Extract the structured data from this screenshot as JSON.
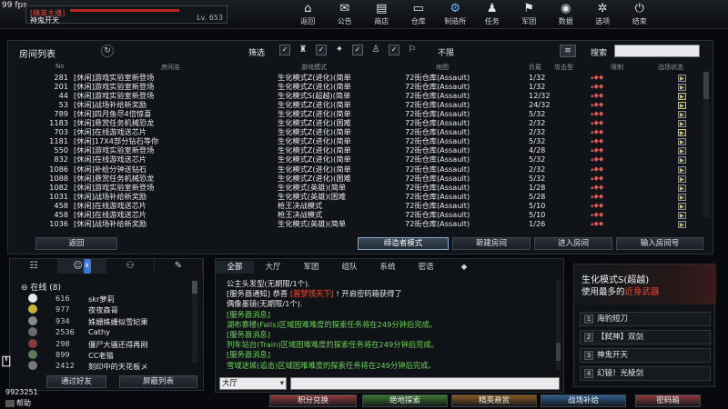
{
  "fps": "99 fps",
  "player": {
    "rank": "[精英主播]",
    "name": "神鬼开天",
    "level": "Lv. 653"
  },
  "menu": [
    {
      "label": "返回",
      "icon": "⌂"
    },
    {
      "label": "公告",
      "icon": "✉"
    },
    {
      "label": "商店",
      "icon": "▤"
    },
    {
      "label": "仓库",
      "icon": "▭"
    },
    {
      "label": "制造所",
      "icon": "⚙"
    },
    {
      "label": "任务",
      "icon": "♟"
    },
    {
      "label": "军团",
      "icon": "⚑"
    },
    {
      "label": "数据",
      "icon": "◉"
    },
    {
      "label": "选项",
      "icon": "✲"
    },
    {
      "label": "结束",
      "icon": "⏻"
    }
  ],
  "room_list": {
    "title": "房间列表",
    "filter_label": "筛选",
    "limit_label": "不限",
    "search_label": "搜索",
    "columns": [
      "No",
      "房间名",
      "游戏模式",
      "地图",
      "负载",
      "攻击型",
      "限制",
      "战场状态"
    ],
    "rows": [
      {
        "no": "281",
        "name": "[休闲]游戏实验室新登场",
        "mode": "生化模式Z(进化)(简单",
        "map": "72街仓库(Assault)",
        "ppl": "1/32",
        "flags": "▴◆◆",
        "state": "wait"
      },
      {
        "no": "201",
        "name": "[休闲]游戏实验室新登场",
        "mode": "生化模式Z(进化)(简单",
        "map": "72街仓库(Assault)",
        "ppl": "1/32",
        "flags": "▴◆◆",
        "state": "wait"
      },
      {
        "no": "44",
        "name": "[休闲]游戏实验室新登场",
        "mode": "生化模式S(超越)(简单",
        "map": "72街仓库(Assault)",
        "ppl": "12/32",
        "flags": "▴◆◆",
        "state": "play"
      },
      {
        "no": "53",
        "name": "[休闲]战场补给新奖励",
        "mode": "生化模式Z(进化)(简单",
        "map": "72街仓库(Assault)",
        "ppl": "24/32",
        "flags": "▴◆◆",
        "state": "play"
      },
      {
        "no": "789",
        "name": "[休闲]四月鱼尽4倍惊喜",
        "mode": "生化模式Z(进化)(简单",
        "map": "72街仓库(Assault)",
        "ppl": "5/32",
        "flags": "▴◆◆",
        "state": "wait"
      },
      {
        "no": "1183",
        "name": "[休闲]悬赏任务机械恐龙",
        "mode": "生化模式Z(进化)(困难",
        "map": "72街仓库(Assault)",
        "ppl": "2/32",
        "flags": "▴◆◆",
        "state": "wait"
      },
      {
        "no": "703",
        "name": "[休闲]在线游戏送芯片",
        "mode": "生化模式Z(进化)(简单",
        "map": "72街仓库(Assault)",
        "ppl": "2/32",
        "flags": "▴◆◆",
        "state": "play"
      },
      {
        "no": "1181",
        "name": "[休闲]17X4部分钻石等你",
        "mode": "生化模式Z(进化)(简单",
        "map": "72街仓库(Assault)",
        "ppl": "5/32",
        "flags": "▴◆◆",
        "state": "wait"
      },
      {
        "no": "550",
        "name": "[休闲]游戏实验室新登场",
        "mode": "生化模式Z(进化)(简单",
        "map": "72街仓库(Assault)",
        "ppl": "4/28",
        "flags": "▴◆◆",
        "state": "wait"
      },
      {
        "no": "832",
        "name": "[休闲]在线游戏送芯片",
        "mode": "生化模式Z(进化)(简单",
        "map": "72街仓库(Assault)",
        "ppl": "5/32",
        "flags": "▴◆◆",
        "state": "wait"
      },
      {
        "no": "1086",
        "name": "[休闲]补给分钟送钻石",
        "mode": "生化模式Z(进化)(简单",
        "map": "72街仓库(Assault)",
        "ppl": "2/32",
        "flags": "▴◆◆",
        "state": "wait"
      },
      {
        "no": "1088",
        "name": "[休闲]悬赏任务机械恐龙",
        "mode": "生化模式Z(进化)(困难",
        "map": "72街仓库(Assault)",
        "ppl": "5/32",
        "flags": "▴◆◆",
        "state": "wait"
      },
      {
        "no": "1082",
        "name": "[休闲]游戏实验室新登场",
        "mode": "生化模式(英雄)(简单",
        "map": "72街仓库(Assault)",
        "ppl": "1/28",
        "flags": "▴◆◆",
        "state": "wait"
      },
      {
        "no": "1031",
        "name": "[休闲]战场补给新奖励",
        "mode": "生化模式(英雄)(困难",
        "map": "72街仓库(Assault)",
        "ppl": "5/28",
        "flags": "▴◆◆",
        "state": "wait"
      },
      {
        "no": "458",
        "name": "[休闲]在线游戏送芯片",
        "mode": "枪王决战模式",
        "map": "72街仓库(Assault)",
        "ppl": "5/10",
        "flags": "▴◆◆",
        "state": "wait"
      },
      {
        "no": "458",
        "name": "[休闲]在线游戏送芯片",
        "mode": "枪王决战模式",
        "map": "72街仓库(Assault)",
        "ppl": "5/10",
        "flags": "▴◆◆",
        "state": "wait"
      },
      {
        "no": "1036",
        "name": "[休闲]战场补给新奖励",
        "mode": "生化模式(英雄)(简单",
        "map": "72街仓库(Assault)",
        "ppl": "1/26",
        "flags": "▴◆◆",
        "state": "wait"
      }
    ],
    "buttons": {
      "back": "返回",
      "observer": "缔造者模式",
      "new_room": "新建房间",
      "enter": "进入房间",
      "enter_number": "输入房间号"
    }
  },
  "friends": {
    "tab_badge": "8",
    "online_label": "在线 (8)",
    "list": [
      {
        "level": "616",
        "name": "skr萝莉"
      },
      {
        "level": "977",
        "name": "夜夜森哥"
      },
      {
        "level": "934",
        "name": "姝姗姝姗似雪妃果"
      },
      {
        "level": "2536",
        "name": "Cathy"
      },
      {
        "level": "298",
        "name": "僵尸大骚还得再刚"
      },
      {
        "level": "899",
        "name": "CC老猫"
      },
      {
        "level": "2412",
        "name": "刻印中的天花板メ"
      }
    ],
    "btn_add": "通过好友",
    "btn_block": "屏蔽列表"
  },
  "user_id": "9923251",
  "help": "帮助",
  "chat": {
    "tabs": [
      "全部",
      "大厅",
      "军团",
      "组队",
      "系统",
      "密语",
      "◆"
    ],
    "lines": [
      {
        "type": "w",
        "text": "公主头发型(无期限/1个)."
      },
      {
        "type": "w",
        "pre": "[服务器通知] 恭喜 ",
        "hl": "[普梦领天下]",
        "post": " ! 开启密码箱获得了"
      },
      {
        "type": "w",
        "text": "偶像墨镜(无期限/1个)."
      },
      {
        "type": "g",
        "text": "[服务器消息]"
      },
      {
        "type": "g",
        "text": "湖布寨楼(Falls)区域困难难度的探索任务将在249分钟后完成。"
      },
      {
        "type": "g",
        "text": "[服务器消息]"
      },
      {
        "type": "g",
        "text": "列车站台(Train)区域困难难度的探索任务将在249分钟后完成。"
      },
      {
        "type": "g",
        "text": "[服务器消息]"
      },
      {
        "type": "g",
        "text": "雪域迷城(追击)区域困难难度的探索任务将在249分钟后完成。"
      }
    ],
    "channel": "大厅"
  },
  "mode_panel": {
    "title": "生化模式S(超越)",
    "subtitle_pre": "使用最多的",
    "subtitle_em": "近身武器",
    "weapons": [
      {
        "n": "1",
        "name": "海豹短刀"
      },
      {
        "n": "2",
        "name": "【弑神】双剑"
      },
      {
        "n": "3",
        "name": "神鬼开天"
      },
      {
        "n": "4",
        "name": "幻镜！光棱剑"
      }
    ]
  },
  "bottom_buttons": [
    {
      "label": "积分兑换",
      "color": "#8f3a3a"
    },
    {
      "label": "绝地探索",
      "color": "#3a7a2a"
    },
    {
      "label": "精英悬赏",
      "color": "#8a5a1f"
    },
    {
      "label": "战场补给",
      "color": "#2f5f8f"
    },
    {
      "label": "密码箱",
      "color": "#8f3a3a"
    }
  ]
}
